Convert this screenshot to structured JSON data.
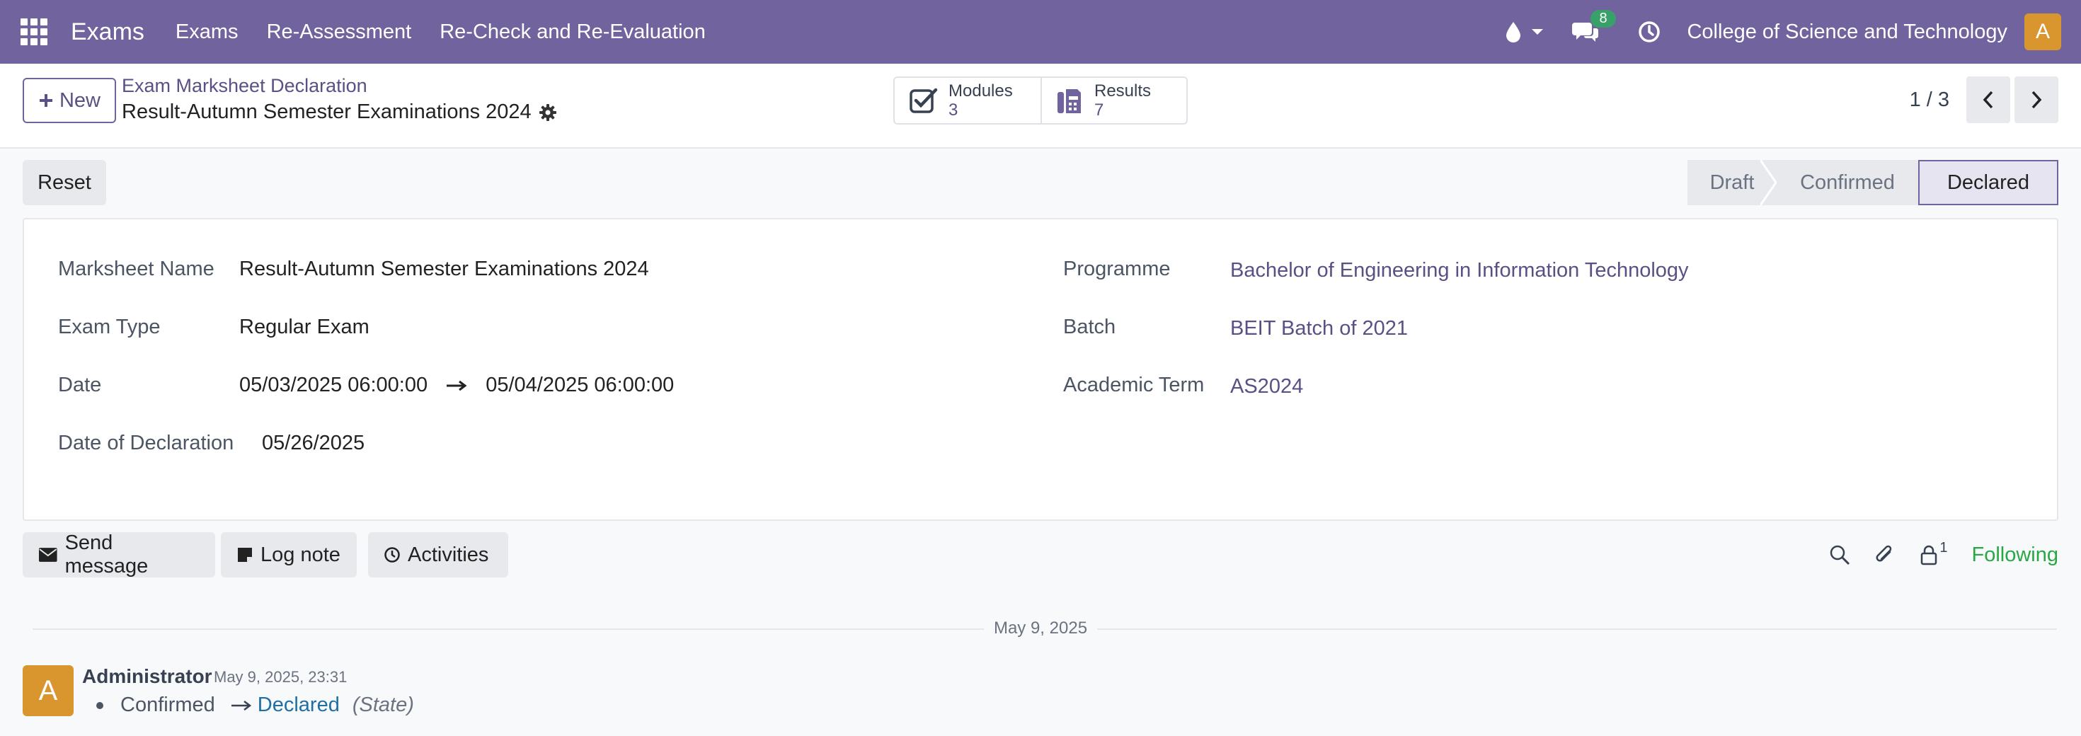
{
  "navbar": {
    "brand": "Exams",
    "menu": [
      "Exams",
      "Re-Assessment",
      "Re-Check and Re-Evaluation"
    ],
    "message_count": "8",
    "company": "College of Science and Technology",
    "avatar_initial": "A",
    "icons": [
      "apps-grid-icon",
      "drop-icon",
      "chat-bubbles-icon",
      "clock-icon"
    ]
  },
  "control_panel": {
    "new_label": "New",
    "breadcrumb": "Exam Marksheet Declaration",
    "record_title": "Result-Autumn Semester Examinations 2024",
    "smart_buttons": [
      {
        "label": "Modules",
        "count": "3",
        "icon": "checkbox-icon"
      },
      {
        "label": "Results",
        "count": "7",
        "icon": "fax-icon"
      }
    ],
    "pager": "1 / 3"
  },
  "statusbar": {
    "reset_label": "Reset",
    "stages": [
      "Draft",
      "Confirmed",
      "Declared"
    ],
    "current": "Declared"
  },
  "form": {
    "marksheet_name": {
      "label": "Marksheet Name",
      "value": "Result-Autumn Semester Examinations 2024"
    },
    "exam_type": {
      "label": "Exam Type",
      "value": "Regular Exam"
    },
    "date": {
      "label": "Date",
      "start": "05/03/2025 06:00:00",
      "end": "05/04/2025 06:00:00"
    },
    "date_of_declaration": {
      "label": "Date of Declaration",
      "value": "05/26/2025"
    },
    "programme": {
      "label": "Programme",
      "value": "Bachelor of Engineering in Information Technology"
    },
    "batch": {
      "label": "Batch",
      "value": "BEIT Batch of 2021"
    },
    "academic_term": {
      "label": "Academic Term",
      "value": "AS2024"
    }
  },
  "chatter": {
    "send_message": "Send message",
    "log_note": "Log note",
    "activities": "Activities",
    "followers_count": "1",
    "following": "Following",
    "date_separator": "May 9, 2025",
    "message": {
      "avatar_initial": "A",
      "author": "Administrator",
      "date": "May 9, 2025, 23:31",
      "old_value": "Confirmed",
      "new_value": "Declared",
      "field": "(State)"
    }
  },
  "colors": {
    "navbar": "#71639e",
    "accent": "#5b4f86",
    "avatar": "#d9962f",
    "following": "#28a745",
    "badge": "#3aa06a"
  }
}
